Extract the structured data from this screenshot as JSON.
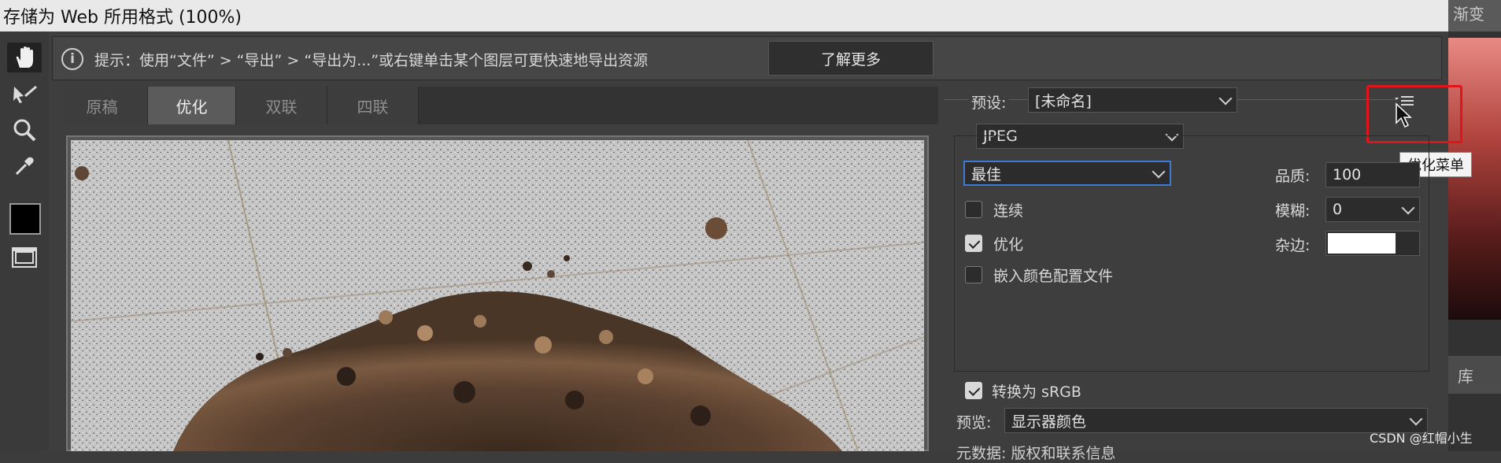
{
  "window": {
    "title": "存储为 Web 所用格式 (100%)"
  },
  "right_panel": {
    "tab_label": "渐变",
    "library_label": "库"
  },
  "toolbar": {
    "tools": [
      "hand-tool",
      "slice-select-tool",
      "zoom-tool",
      "eyedropper-tool",
      "toggle-slice-visibility"
    ],
    "eyedropper_color": "#000000"
  },
  "hint": {
    "text": "提示：使用“文件” > “导出” > “导出为...”或右键单击某个图层可更快速地导出资源",
    "button": "了解更多"
  },
  "tabs": [
    {
      "label": "原稿",
      "active": false
    },
    {
      "label": "优化",
      "active": true
    },
    {
      "label": "双联",
      "active": false
    },
    {
      "label": "四联",
      "active": false
    }
  ],
  "settings": {
    "preset_label": "预设:",
    "preset_value": "[未命名]",
    "format_value": "JPEG",
    "quality_preset": "最佳",
    "quality_label": "品质:",
    "quality_value": "100",
    "blur_label": "模糊:",
    "blur_value": "0",
    "matte_label": "杂边:",
    "matte_color": "#ffffff",
    "progressive_label": "连续",
    "progressive_checked": false,
    "optimized_label": "优化",
    "optimized_checked": true,
    "embed_profile_label": "嵌入颜色配置文件",
    "embed_profile_checked": false,
    "convert_srgb_label": "转换为 sRGB",
    "convert_srgb_checked": true,
    "preview_label": "预览:",
    "preview_value": "显示器颜色",
    "metadata_partial": "元数据:  版权和联系信息"
  },
  "optimize_menu_tooltip": "优化菜单",
  "watermark": "CSDN @红帽小生"
}
